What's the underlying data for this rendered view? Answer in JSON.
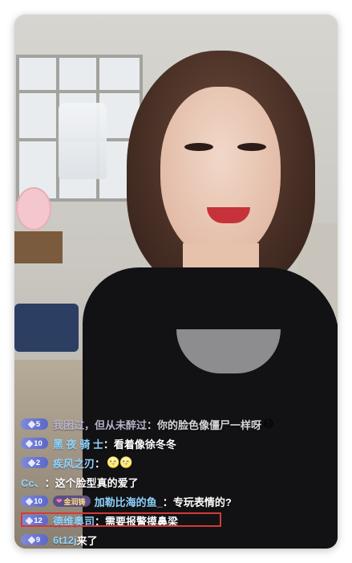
{
  "comments": [
    {
      "level": "5",
      "user": "我困过，但从未醉过",
      "separator": "：",
      "text": "你的脸色像僵尸一样呀",
      "emoji": "😷",
      "dim": true
    },
    {
      "level": "10",
      "user": "黑 夜 骑 士",
      "separator": "：",
      "text": "看着像徐冬冬"
    },
    {
      "level": "2",
      "user": "疾风之刃",
      "separator": "：",
      "text": "",
      "emoji": "🌝🌝"
    },
    {
      "level": "",
      "user": "Cc、",
      "separator": "：",
      "text": "这个脸型真的爱了"
    },
    {
      "level": "10",
      "badge": "金润铸",
      "user": "加勒比海的鱼_",
      "separator": "：",
      "text": "专玩表情的?"
    },
    {
      "level": "12",
      "user": "德维奥司",
      "separator": "：",
      "text": "需要报警摸鼻梁",
      "highlighted": true
    },
    {
      "level": "9",
      "user": "6t12j",
      "separator": " ",
      "text": "来了"
    }
  ],
  "colors": {
    "username": "#8fd5ff",
    "message": "#ffffff",
    "level_badge": "#6a76d0",
    "highlight_border": "#d23a3a"
  }
}
